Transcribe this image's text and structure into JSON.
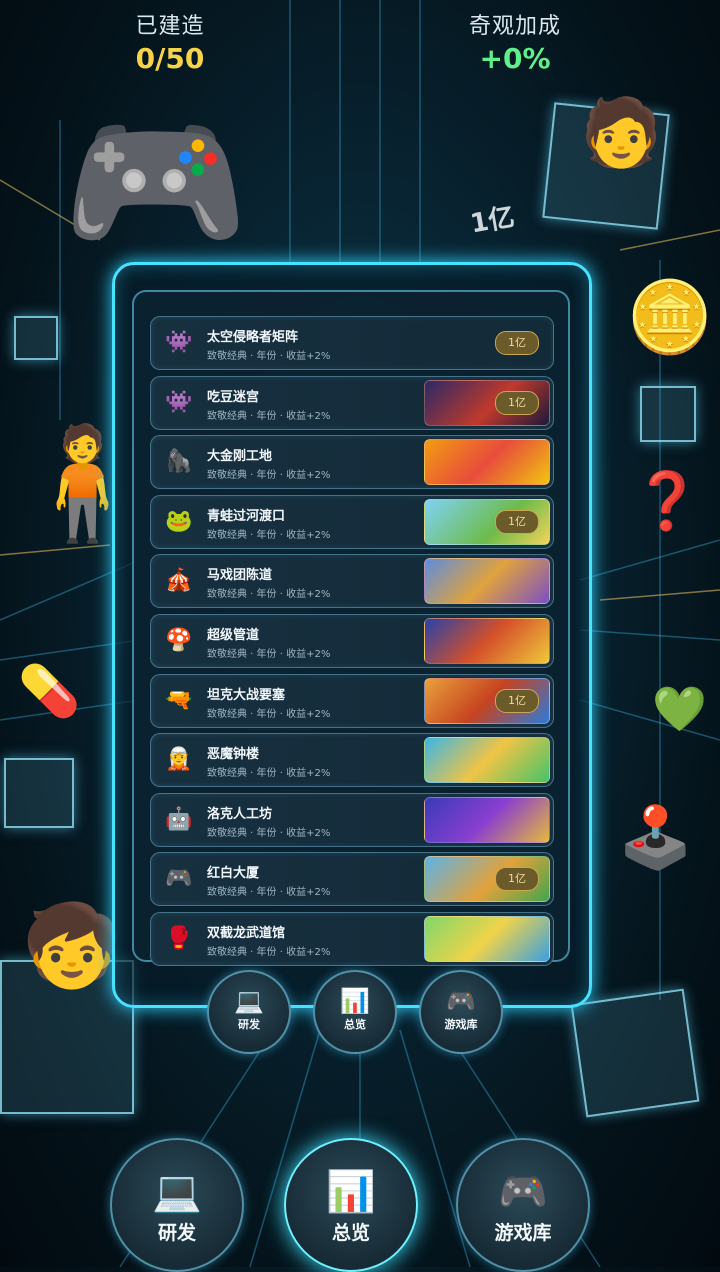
{
  "header": {
    "built_label": "已建造",
    "built_value": "0/50",
    "wonder_label": "奇观加成",
    "wonder_value": "+0%"
  },
  "floating_tag": "1亿",
  "games": [
    {
      "icon": "👾",
      "icon_name": "space-invader-icon",
      "title": "太空侵略者矩阵",
      "subtitle": "致敬经典 · 年份 · 收益+2%",
      "badge": "1亿",
      "has_thumb": false
    },
    {
      "icon": "👾",
      "icon_name": "pacman-ghost-icon",
      "title": "吃豆迷宫",
      "subtitle": "致敬经典 · 年份 · 收益+2%",
      "badge": "1亿",
      "has_thumb": true
    },
    {
      "icon": "🦍",
      "icon_name": "gorilla-icon",
      "title": "大金刚工地",
      "subtitle": "致敬经典 · 年份 · 收益+2%",
      "badge": "",
      "has_thumb": true
    },
    {
      "icon": "🐸",
      "icon_name": "frog-icon",
      "title": "青蛙过河渡口",
      "subtitle": "致敬经典 · 年份 · 收益+2%",
      "badge": "1亿",
      "has_thumb": true
    },
    {
      "icon": "🎪",
      "icon_name": "circus-tent-icon",
      "title": "马戏团陈道",
      "subtitle": "致敬经典 · 年份 · 收益+2%",
      "badge": "",
      "has_thumb": true
    },
    {
      "icon": "🍄",
      "icon_name": "mushroom-icon",
      "title": "超级管道",
      "subtitle": "致敬经典 · 年份 · 收益+2%",
      "badge": "",
      "has_thumb": true
    },
    {
      "icon": "🔫",
      "icon_name": "tank-gun-icon",
      "title": "坦克大战要塞",
      "subtitle": "致敬经典 · 年份 · 收益+2%",
      "badge": "1亿",
      "has_thumb": true
    },
    {
      "icon": "🧝",
      "icon_name": "princess-icon",
      "title": "恶魔钟楼",
      "subtitle": "致敬经典 · 年份 · 收益+2%",
      "badge": "",
      "has_thumb": true
    },
    {
      "icon": "🤖",
      "icon_name": "robot-icon",
      "title": "洛克人工坊",
      "subtitle": "致敬经典 · 年份 · 收益+2%",
      "badge": "",
      "has_thumb": true
    },
    {
      "icon": "🎮",
      "icon_name": "gamepad-icon",
      "title": "红白大厦",
      "subtitle": "致敬经典 · 年份 · 收益+2%",
      "badge": "1亿",
      "has_thumb": true
    },
    {
      "icon": "🥊",
      "icon_name": "boxing-glove-icon",
      "title": "双截龙武道馆",
      "subtitle": "致敬经典 · 年份 · 收益+2%",
      "badge": "",
      "has_thumb": true
    }
  ],
  "nav_small": [
    {
      "label": "研发",
      "glyph": "💻",
      "icon_name": "laptop-icon"
    },
    {
      "label": "总览",
      "glyph": "📊",
      "icon_name": "bar-chart-icon"
    },
    {
      "label": "游戏库",
      "glyph": "🎮",
      "icon_name": "gamepad-icon"
    }
  ],
  "nav_big": [
    {
      "label": "研发",
      "glyph": "💻",
      "icon_name": "laptop-icon"
    },
    {
      "label": "总览",
      "glyph": "📊",
      "icon_name": "bar-chart-icon",
      "active": true
    },
    {
      "label": "游戏库",
      "glyph": "🎮",
      "icon_name": "gamepad-icon"
    }
  ],
  "colors": {
    "accent": "#47e3ff",
    "gold": "#f7d34a",
    "green": "#5ef08a"
  }
}
